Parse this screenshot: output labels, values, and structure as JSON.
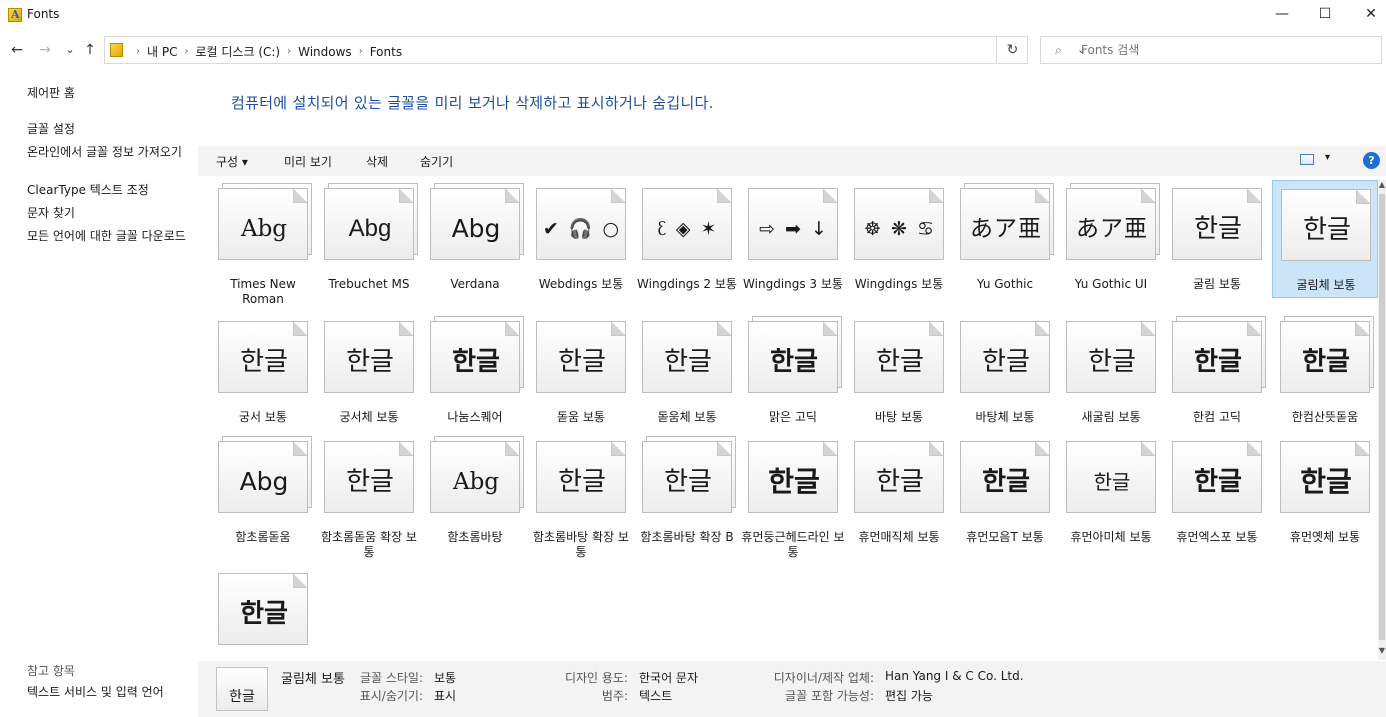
{
  "window": {
    "title": "Fonts",
    "minimize": "—",
    "maximize": "☐",
    "close": "✕"
  },
  "nav": {
    "back": "←",
    "forward": "→",
    "recent": "⌄",
    "up": "↑",
    "breadcrumbs": [
      "내 PC",
      "로컬 디스크 (C:)",
      "Windows",
      "Fonts"
    ],
    "address_dropdown": "⌄",
    "refresh": "↻",
    "search_placeholder": "Fonts 검색"
  },
  "sidebar": {
    "home": "제어판 홈",
    "links": [
      "글꼴 설정",
      "온라인에서 글꼴 정보 가져오기",
      "ClearType 텍스트 조정",
      "문자 찾기",
      "모든 언어에 대한 글꼴 다운로드"
    ],
    "see_also_title": "참고 항목",
    "see_also": [
      "텍스트 서비스 및 입력 언어"
    ]
  },
  "main": {
    "headline": "컴퓨터에 설치되어 있는 글꼴을 미리 보거나 삭제하고 표시하거나 숨깁니다.",
    "commands": [
      "구성 ▾",
      "미리 보기",
      "삭제",
      "숨기기"
    ],
    "view_dropdown": "▾",
    "help": "?"
  },
  "fonts": [
    {
      "name": "Times New Roman",
      "sample": "Abg",
      "family": true
    },
    {
      "name": "Trebuchet MS",
      "sample": "Abg",
      "family": true
    },
    {
      "name": "Verdana",
      "sample": "Abg",
      "family": true
    },
    {
      "name": "Webdings 보통",
      "sample": "✔ 🎧 ○",
      "family": false
    },
    {
      "name": "Wingdings 2 보통",
      "sample": "ᦷ ◈ ✶",
      "family": false
    },
    {
      "name": "Wingdings 3 보통",
      "sample": "⇨ ➡ ↓",
      "family": false
    },
    {
      "name": "Wingdings 보통",
      "sample": "☸ ❋ ♋",
      "family": false
    },
    {
      "name": "Yu Gothic",
      "sample": "あア亜",
      "family": true
    },
    {
      "name": "Yu Gothic UI",
      "sample": "あア亜",
      "family": true
    },
    {
      "name": "굴림 보통",
      "sample": "한글",
      "family": false
    },
    {
      "name": "굴림체 보통",
      "sample": "한글",
      "family": false,
      "selected": true
    },
    {
      "name": "궁서 보통",
      "sample": "한글",
      "family": false
    },
    {
      "name": "궁서체 보통",
      "sample": "한글",
      "family": false
    },
    {
      "name": "나눔스퀘어",
      "sample": "한글",
      "family": true
    },
    {
      "name": "돋움 보통",
      "sample": "한글",
      "family": false
    },
    {
      "name": "돋움체 보통",
      "sample": "한글",
      "family": false
    },
    {
      "name": "맑은 고딕",
      "sample": "한글",
      "family": true
    },
    {
      "name": "바탕 보통",
      "sample": "한글",
      "family": false
    },
    {
      "name": "바탕체 보통",
      "sample": "한글",
      "family": false
    },
    {
      "name": "새굴림 보통",
      "sample": "한글",
      "family": false
    },
    {
      "name": "한컴 고딕",
      "sample": "한글",
      "family": true
    },
    {
      "name": "한컴산뜻돋움",
      "sample": "한글",
      "family": true
    },
    {
      "name": "함초롬돋움",
      "sample": "Abg",
      "family": true
    },
    {
      "name": "함초롬돋움 확장 보통",
      "sample": "한글",
      "family": false
    },
    {
      "name": "함초롬바탕",
      "sample": "Abg",
      "family": true
    },
    {
      "name": "함초롬바탕 확장 보통",
      "sample": "한글",
      "family": false
    },
    {
      "name": "함초롬바탕 확장 B",
      "sample": "한글",
      "family": true
    },
    {
      "name": "휴먼둥근헤드라인 보통",
      "sample": "한글",
      "family": false
    },
    {
      "name": "휴먼매직체 보통",
      "sample": "한글",
      "family": false
    },
    {
      "name": "휴먼모음T 보통",
      "sample": "한글",
      "family": false
    },
    {
      "name": "휴먼아미체 보통",
      "sample": "한글",
      "family": false
    },
    {
      "name": "휴먼엑스포 보통",
      "sample": "한글",
      "family": false
    },
    {
      "name": "휴먼옛체 보통",
      "sample": "한글",
      "family": false
    },
    {
      "name": "",
      "sample": "한글",
      "family": false
    }
  ],
  "details": {
    "thumb_sample": "한글",
    "name": "굴림체 보통",
    "style_label": "글꼴 스타일:",
    "style_value": "보통",
    "show_label": "표시/숨기기:",
    "show_value": "표시",
    "use_label": "디자인 용도:",
    "use_value": "한국어 문자",
    "category_label": "범주:",
    "category_value": "텍스트",
    "designer_label": "디자이너/제작 업체:",
    "designer_value": "Han Yang I & C Co. Ltd.",
    "embed_label": "글꼴 포함 가능성:",
    "embed_value": "편집 가능"
  },
  "colors": {
    "headline": "#1e4f9c",
    "selection": "#cce4f7",
    "help": "#1f6fcf"
  }
}
